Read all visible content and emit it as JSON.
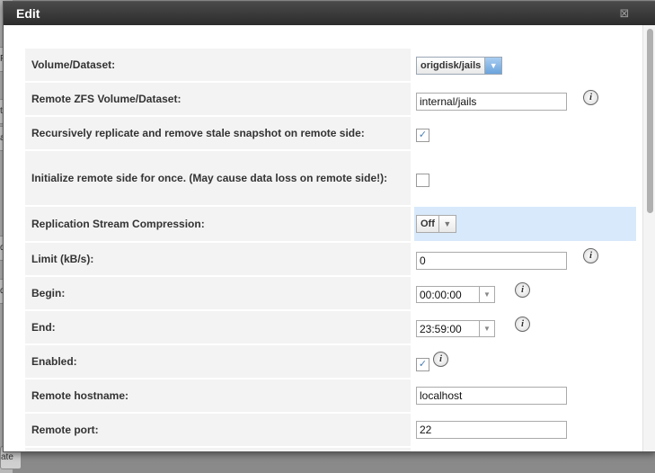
{
  "dialog": {
    "title": "Edit",
    "close_glyph": "⊠"
  },
  "background": {
    "tab_fragments": [
      "P",
      "ti",
      "as",
      "di",
      "dl"
    ],
    "bottom_button": "ate"
  },
  "form": {
    "volume_dataset": {
      "label": "Volume/Dataset:",
      "value": "origdisk/jails"
    },
    "remote_dataset": {
      "label": "Remote ZFS Volume/Dataset:",
      "value": "internal/jails"
    },
    "recursive": {
      "label": "Recursively replicate and remove stale snapshot on remote side:",
      "checked": true
    },
    "initialize": {
      "label": "Initialize remote side for once. (May cause data loss on remote side!):",
      "checked": false
    },
    "compression": {
      "label": "Replication Stream Compression:",
      "value": "Off"
    },
    "limit": {
      "label": "Limit (kB/s):",
      "value": "0"
    },
    "begin": {
      "label": "Begin:",
      "value": "00:00:00"
    },
    "end": {
      "label": "End:",
      "value": "23:59:00"
    },
    "enabled": {
      "label": "Enabled:",
      "checked": true
    },
    "remote_hostname": {
      "label": "Remote hostname:",
      "value": "localhost"
    },
    "remote_port": {
      "label": "Remote port:",
      "value": "22"
    }
  },
  "icons": {
    "info": "info-icon",
    "checkmark": "✓",
    "dropdown": "▼",
    "info_glyph": "i"
  },
  "colors": {
    "titlebar": "#333333",
    "label_bg": "#f3f3f3",
    "highlight": "#d8e9fb"
  }
}
